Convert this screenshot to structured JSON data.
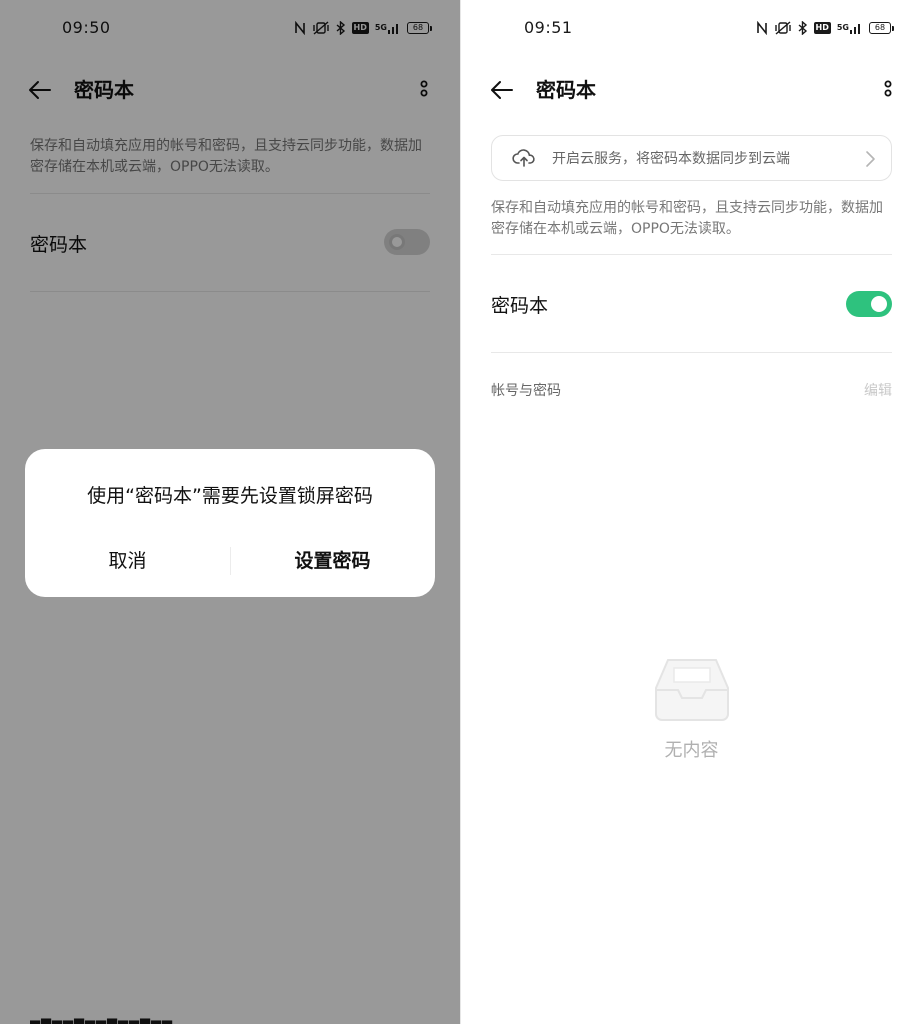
{
  "left_screen": {
    "status_bar": {
      "time": "09:50",
      "battery": "68",
      "network": "5G",
      "hd": "HD"
    },
    "toolbar": {
      "title": "密码本"
    },
    "description": "保存和自动填充应用的帐号和密码，且支持云同步功能，数据加密存储在本机或云端，OPPO无法读取。",
    "toggle_row": {
      "label": "密码本",
      "state": "off"
    },
    "dialog": {
      "message": "使用“密码本”需要先设置锁屏密码",
      "cancel_label": "取消",
      "confirm_label": "设置密码"
    }
  },
  "right_screen": {
    "status_bar": {
      "time": "09:51",
      "battery": "68",
      "network": "5G",
      "hd": "HD"
    },
    "toolbar": {
      "title": "密码本"
    },
    "cloud_banner": {
      "text": "开启云服务，将密码本数据同步到云端"
    },
    "description": "保存和自动填充应用的帐号和密码，且支持云同步功能，数据加密存储在本机或云端，OPPO无法读取。",
    "toggle_row": {
      "label": "密码本",
      "state": "on"
    },
    "section": {
      "label": "帐号与密码",
      "edit_label": "编辑"
    },
    "empty_state": {
      "text": "无内容"
    }
  },
  "colors": {
    "accent": "#2ec27e",
    "scrim": "rgba(0,0,0,0.40)",
    "muted_text": "#777777"
  },
  "icons": [
    "back-arrow-icon",
    "more-vertical-icon",
    "cloud-upload-icon",
    "chevron-right-icon",
    "nfc-icon",
    "vibrate-icon",
    "bluetooth-icon",
    "battery-icon",
    "empty-tray-icon"
  ]
}
